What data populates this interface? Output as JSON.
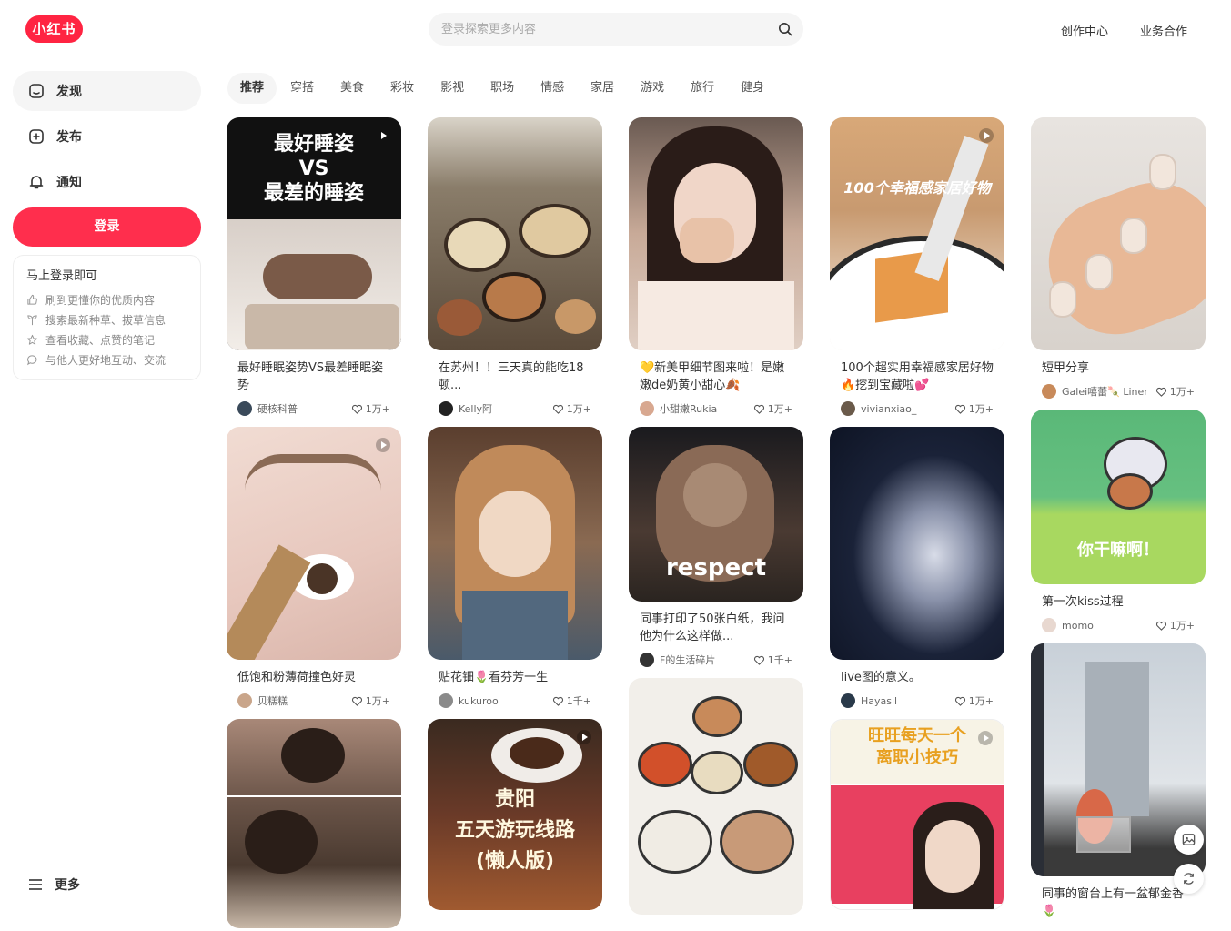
{
  "brand": {
    "logo_text": "小红书",
    "color": "#ff2442"
  },
  "search": {
    "placeholder": "登录探索更多内容"
  },
  "header_links": [
    "创作中心",
    "业务合作"
  ],
  "sidebar": {
    "items": [
      {
        "label": "发现",
        "icon": "home-icon"
      },
      {
        "label": "发布",
        "icon": "plus-square-icon"
      },
      {
        "label": "通知",
        "icon": "bell-icon"
      }
    ],
    "login_label": "登录",
    "login_card": {
      "title": "马上登录即可",
      "rows": [
        "刷到更懂你的优质内容",
        "搜索最新种草、拔草信息",
        "查看收藏、点赞的笔记",
        "与他人更好地互动、交流"
      ]
    },
    "more_label": "更多"
  },
  "tabs": [
    "推荐",
    "穿搭",
    "美食",
    "彩妆",
    "影视",
    "职场",
    "情感",
    "家居",
    "游戏",
    "旅行",
    "健身"
  ],
  "feed": {
    "columns": [
      [
        {
          "title": "最好睡眠姿势VS最差睡眠姿势",
          "author": "硬核科普",
          "likes": "1万+",
          "cover_text": "最好睡姿\nVS\n最差的睡姿"
        },
        {
          "title": "低饱和粉薄荷撞色好灵",
          "author": "贝糕糕",
          "likes": "1万+",
          "cover_text": ""
        },
        {
          "title": "",
          "author": "",
          "likes": "",
          "cover_text": ""
        }
      ],
      [
        {
          "title": "在苏州！！三天真的能吃18顿...",
          "author": "Kelly阿",
          "likes": "1万+",
          "cover_text": ""
        },
        {
          "title": "贴花钿🌷看芬芳一生",
          "author": "kukuroo",
          "likes": "1千+",
          "cover_text": ""
        },
        {
          "title": "",
          "author": "",
          "likes": "",
          "cover_text": "贵阳\n五天游玩线路\n(懒人版)"
        }
      ],
      [
        {
          "title": "💛新美甲细节图来啦！是嫩嫩de奶黄小甜心🍂",
          "author": "小甜嫩Rukia",
          "likes": "1万+",
          "cover_text": ""
        },
        {
          "title": "同事打印了50张白纸，我问他为什么这样做...",
          "author": "F的生活碎片",
          "likes": "1千+",
          "cover_text": "respect"
        },
        {
          "title": "",
          "author": "",
          "likes": "",
          "cover_text": ""
        }
      ],
      [
        {
          "title": "100个超实用幸福感家居好物🔥挖到宝藏啦💕",
          "author": "vivianxiao_",
          "likes": "1万+",
          "cover_text": "100个幸福感家居好物"
        },
        {
          "title": "live图的意义。",
          "author": "Hayasil",
          "likes": "1万+",
          "cover_text": ""
        },
        {
          "title": "",
          "author": "",
          "likes": "",
          "cover_text": "旺旺每天一个\n离职小技巧"
        }
      ],
      [
        {
          "title": "短甲分享",
          "author": "Galei嘻蕾🍡 Liner",
          "likes": "1万+",
          "cover_text": ""
        },
        {
          "title": "第一次kiss过程",
          "author": "momo",
          "likes": "1万+",
          "cover_text": "你干嘛啊！"
        },
        {
          "title": "同事的窗台上有一盆郁金香🌷",
          "author": "",
          "likes": "",
          "cover_text": ""
        }
      ]
    ]
  },
  "floating_buttons": [
    "image-icon",
    "refresh-icon"
  ]
}
